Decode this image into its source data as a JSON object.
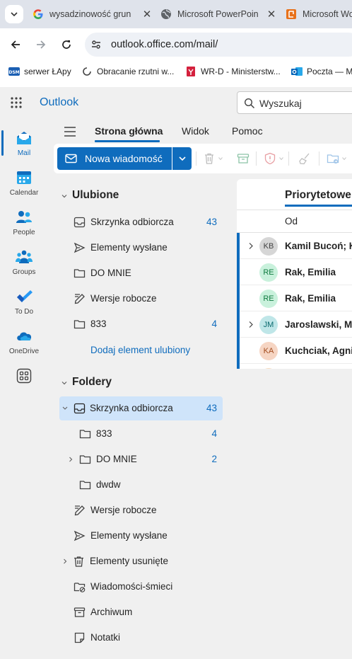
{
  "browser": {
    "tabs": [
      {
        "title": "wysadzinowość grun",
        "favicon": "google-icon"
      },
      {
        "title": "Microsoft PowerPoin",
        "favicon": "globe-icon"
      },
      {
        "title": "Microsoft Wo",
        "favicon": "office-icon"
      }
    ],
    "url": "outlook.office.com/mail/",
    "bookmarks": [
      {
        "label": "serwer ŁApy",
        "icon": "dsm-icon"
      },
      {
        "label": "Obracanie rzutni w...",
        "icon": "loading-icon"
      },
      {
        "label": "WR-D - Ministerstw...",
        "icon": "emblem-icon"
      },
      {
        "label": "Poczta — M",
        "icon": "outlook-icon"
      }
    ]
  },
  "app": {
    "title": "Outlook",
    "search_placeholder": "Wyszukaj"
  },
  "rail": [
    {
      "label": "Mail",
      "icon": "mail-icon",
      "active": true
    },
    {
      "label": "Calendar",
      "icon": "calendar-icon"
    },
    {
      "label": "People",
      "icon": "people-icon"
    },
    {
      "label": "Groups",
      "icon": "groups-icon"
    },
    {
      "label": "To Do",
      "icon": "todo-icon"
    },
    {
      "label": "OneDrive",
      "icon": "onedrive-icon"
    },
    {
      "label": "",
      "icon": "more-apps-icon"
    }
  ],
  "ribbon": {
    "tabs": [
      "Strona główna",
      "Widok",
      "Pomoc"
    ],
    "new_message": "Nowa wiadomość",
    "commands": [
      "delete-icon",
      "archive-icon",
      "report-icon",
      "sweep-icon",
      "move-icon"
    ]
  },
  "favorites": {
    "title": "Ulubione",
    "items": [
      {
        "label": "Skrzynka odbiorcza",
        "count": "43",
        "icon": "inbox-icon"
      },
      {
        "label": "Elementy wysłane",
        "count": "",
        "icon": "send-icon"
      },
      {
        "label": "DO MNIE",
        "count": "",
        "icon": "folder-icon"
      },
      {
        "label": "Wersje robocze",
        "count": "",
        "icon": "draft-icon"
      },
      {
        "label": "833",
        "count": "4",
        "icon": "folder-icon"
      }
    ],
    "add_favorite": "Dodaj element ulubiony"
  },
  "folders": {
    "title": "Foldery",
    "items": [
      {
        "label": "Skrzynka odbiorcza",
        "count": "43",
        "icon": "inbox-icon"
      },
      {
        "label": "833",
        "count": "4",
        "icon": "folder-icon"
      },
      {
        "label": "DO MNIE",
        "count": "2",
        "icon": "folder-icon"
      },
      {
        "label": "dwdw",
        "count": "",
        "icon": "folder-icon"
      },
      {
        "label": "Wersje robocze",
        "count": "",
        "icon": "draft-icon"
      },
      {
        "label": "Elementy wysłane",
        "count": "",
        "icon": "send-icon"
      },
      {
        "label": "Elementy usunięte",
        "count": "",
        "icon": "trash-icon"
      },
      {
        "label": "Wiadomości-śmieci",
        "count": "",
        "icon": "junk-icon"
      },
      {
        "label": "Archiwum",
        "count": "",
        "icon": "archive-icon"
      },
      {
        "label": "Notatki",
        "count": "",
        "icon": "notes-icon"
      }
    ]
  },
  "messagelist": {
    "tab": "Priorytetowe",
    "column_from": "Od",
    "messages": [
      {
        "sender": "Kamil Bucoń; K",
        "initials": "KB",
        "avatar_bg": "#d6d6d6",
        "avatar_fg": "#424242"
      },
      {
        "sender": "Rak, Emilia",
        "initials": "RE",
        "avatar_bg": "#c9f1dc",
        "avatar_fg": "#0e7a3e"
      },
      {
        "sender": "Rak, Emilia",
        "initials": "RE",
        "avatar_bg": "#c9f1dc",
        "avatar_fg": "#0e7a3e"
      },
      {
        "sender": "Jaroslawski, Mi",
        "initials": "JM",
        "avatar_bg": "#bfe6e8",
        "avatar_fg": "#0b6a6f"
      },
      {
        "sender": "Kuchciak, Agni",
        "initials": "KA",
        "avatar_bg": "#f6d5c3",
        "avatar_fg": "#a34d1f"
      }
    ]
  },
  "colors": {
    "accent": "#0f6cbd",
    "selected_folder": "#cfe4fa",
    "pane_background": "#f0f0f0"
  }
}
